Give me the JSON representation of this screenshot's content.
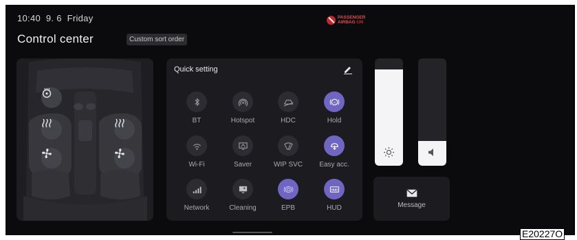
{
  "status": {
    "time": "10:40",
    "date": "9. 6",
    "day": "Friday"
  },
  "airbag": {
    "line1": "PASSENGER",
    "line2": "AIRBAG",
    "state": "ON"
  },
  "header": {
    "title": "Control center",
    "sort_button": "Custom sort order"
  },
  "quick_setting": {
    "title": "Quick setting",
    "items": [
      {
        "label": "BT",
        "icon": "bluetooth-icon",
        "active": false
      },
      {
        "label": "Hotspot",
        "icon": "hotspot-icon",
        "active": false
      },
      {
        "label": "HDC",
        "icon": "hdc-icon",
        "active": false
      },
      {
        "label": "Hold",
        "icon": "auto-hold-icon",
        "active": true
      },
      {
        "label": "Wi-Fi",
        "icon": "wifi-icon",
        "active": false
      },
      {
        "label": "Saver",
        "icon": "screen-saver-icon",
        "active": false
      },
      {
        "label": "WIP SVC",
        "icon": "wiper-service-icon",
        "active": false
      },
      {
        "label": "Easy acc.",
        "icon": "easy-access-icon",
        "active": true
      },
      {
        "label": "Network",
        "icon": "network-signal-icon",
        "active": false
      },
      {
        "label": "Cleaning",
        "icon": "screen-cleaning-icon",
        "active": false
      },
      {
        "label": "EPB",
        "icon": "parking-brake-icon",
        "active": true
      },
      {
        "label": "HUD",
        "icon": "hud-icon",
        "active": true
      }
    ]
  },
  "sliders": {
    "brightness": {
      "icon": "brightness-icon",
      "level": 0.9
    },
    "volume": {
      "icon": "volume-icon",
      "level": 0.23
    }
  },
  "message": {
    "label": "Message",
    "icon": "envelope-icon"
  },
  "figure_code": "E20227O",
  "colors": {
    "background": "#0b0b0d",
    "panel": "#1c1c20",
    "accent": "#6f66c4",
    "airbag": "#c2272d"
  }
}
